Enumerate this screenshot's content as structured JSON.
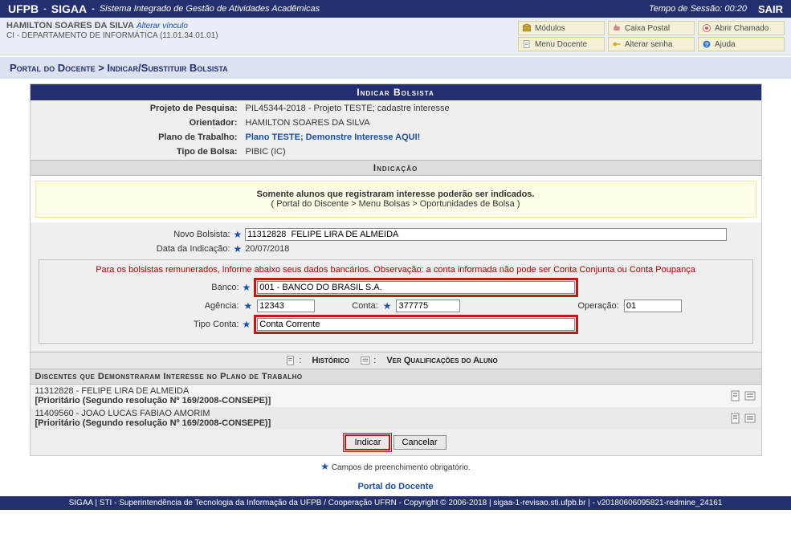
{
  "top": {
    "inst": "UFPB",
    "sys": "SIGAA",
    "sys_full": "Sistema Integrado de Gestão de Atividades Acadêmicas",
    "session_lbl": "Tempo de Sessão:",
    "session_t": "00:20",
    "exit": "SAIR"
  },
  "user": {
    "name": "HAMILTON SOARES DA SILVA",
    "alt": "Alterar vínculo",
    "dept": "CI - DEPARTAMENTO DE INFORMÁTICA (11.01.34.01.01)"
  },
  "menu": {
    "modulos": "Módulos",
    "caixa": "Caixa Postal",
    "chamado": "Abrir Chamado",
    "menudoc": "Menu Docente",
    "senha": "Alterar senha",
    "ajuda": "Ajuda"
  },
  "breadcrumb": "Portal do Docente > Indicar/Substituir Bolsista",
  "sect": {
    "main": "Indicar Bolsista",
    "ind": "Indicação",
    "disc": "Discentes que Demonstraram Interesse no Plano de Trabalho"
  },
  "info": {
    "proj_lbl": "Projeto de Pesquisa:",
    "proj_val": "PIL45344-2018 - Projeto TESTE; cadastre interesse",
    "ori_lbl": "Orientador:",
    "ori_val": "HAMILTON SOARES DA SILVA",
    "plano_lbl": "Plano de Trabalho:",
    "plano_val": "Plano TESTE; Demonstre Interesse AQUI!",
    "tipo_lbl": "Tipo de Bolsa:",
    "tipo_val": "PIBIC (IC)"
  },
  "notice": {
    "l1": "Somente alunos que registraram interesse poderão ser indicados.",
    "l2": "( Portal do Discente > Menu Bolsas > Oportunidades de Bolsa )"
  },
  "form": {
    "novo_lbl": "Novo Bolsista:",
    "novo_val": "11312828  FELIPE LIRA DE ALMEIDA",
    "data_lbl": "Data da Indicação:",
    "data_val": "20/07/2018",
    "bank_legend": "Para os bolsistas remunerados, informe abaixo seus dados bancários. Observação: a conta informada não pode ser Conta Conjunta ou Conta Poupança",
    "banco_lbl": "Banco:",
    "banco_val": "001 - BANCO DO BRASIL S.A.",
    "ag_lbl": "Agência:",
    "ag_val": "12343",
    "conta_lbl": "Conta:",
    "conta_val": "377775",
    "op_lbl": "Operação:",
    "op_val": "01",
    "tc_lbl": "Tipo Conta:",
    "tc_val": "Conta Corrente"
  },
  "mid_actions": {
    "hist": "Histórico",
    "qual": "Ver Qualificações do Aluno"
  },
  "discentes": [
    {
      "mat": "11312828",
      "nome": "FELIPE LIRA DE ALMEIDA",
      "pri": "[Prioritário (Segundo resolução Nº 169/2008-CONSEPE)]"
    },
    {
      "mat": "11409560",
      "nome": "JOAO LUCAS FABIAO AMORIM",
      "pri": "[Prioritário (Segundo resolução Nº 169/2008-CONSEPE)]"
    }
  ],
  "buttons": {
    "indicar": "Indicar",
    "cancelar": "Cancelar"
  },
  "req_note": "Campos de preenchimento obrigatório.",
  "footer": {
    "link": "Portal do Docente",
    "bar": "SIGAA | STI - Superintendência de Tecnologia da Informação da UFPB / Cooperação UFRN - Copyright © 2006-2018 | sigaa-1-revisao.sti.ufpb.br | - v20180606095821-redmine_24161"
  }
}
